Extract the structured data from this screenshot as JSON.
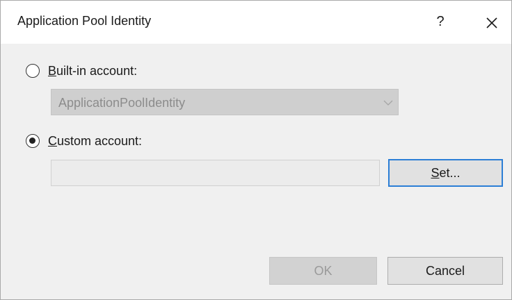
{
  "window": {
    "title": "Application Pool Identity",
    "help_label": "?",
    "close_icon": "close-icon"
  },
  "builtin": {
    "selected": false,
    "label_accel": "B",
    "label_rest": "uilt-in account:",
    "select_value": "ApplicationPoolIdentity",
    "enabled": false
  },
  "custom": {
    "selected": true,
    "label_accel": "C",
    "label_rest": "ustom account:",
    "input_value": ""
  },
  "buttons": {
    "set_accel": "S",
    "set_rest": "et...",
    "ok_label": "OK",
    "ok_enabled": false,
    "cancel_label": "Cancel"
  },
  "colors": {
    "focus_border": "#2b7ed6",
    "dialog_background": "#f0f0f0",
    "disabled_text": "#8c8c8c"
  }
}
